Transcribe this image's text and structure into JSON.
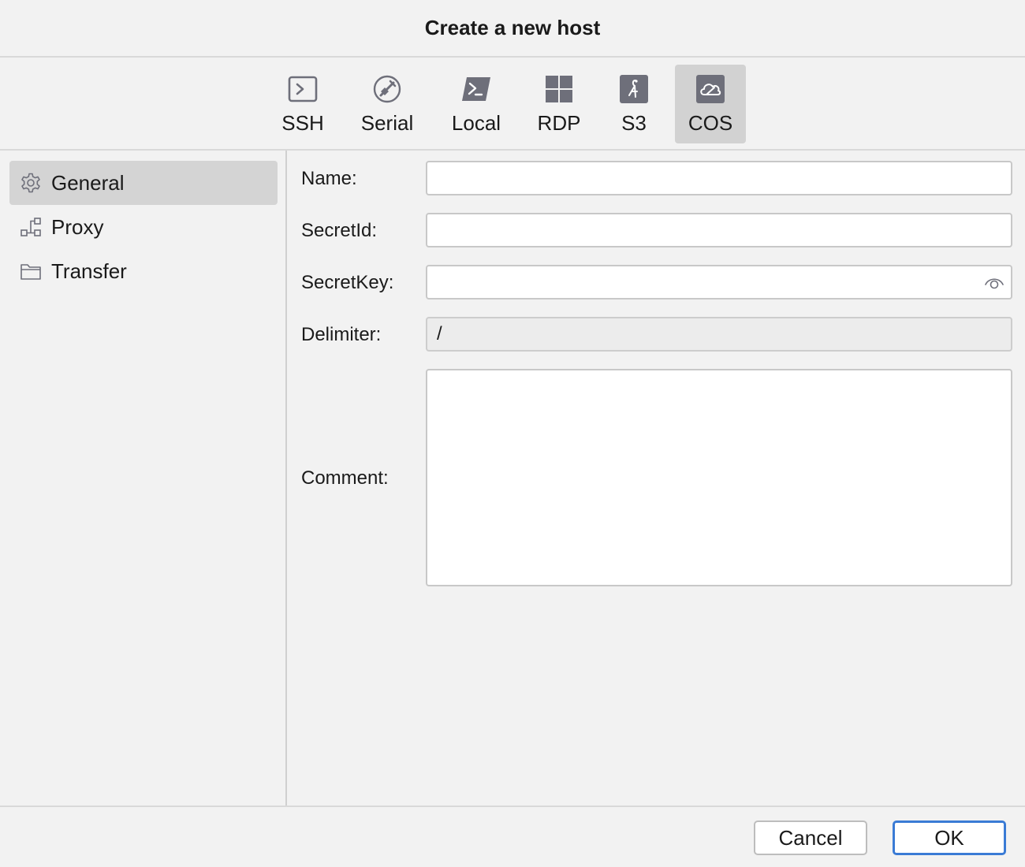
{
  "dialog": {
    "title": "Create a new host"
  },
  "host_types": [
    {
      "label": "SSH",
      "icon": "terminal-icon"
    },
    {
      "label": "Serial",
      "icon": "serial-plug-icon"
    },
    {
      "label": "Local",
      "icon": "powershell-icon"
    },
    {
      "label": "RDP",
      "icon": "windows-icon"
    },
    {
      "label": "S3",
      "icon": "s3-bird-icon"
    },
    {
      "label": "COS",
      "icon": "cloud-icon",
      "selected": true
    }
  ],
  "sidebar": {
    "items": [
      {
        "label": "General",
        "icon": "gear-icon",
        "selected": true
      },
      {
        "label": "Proxy",
        "icon": "proxy-icon"
      },
      {
        "label": "Transfer",
        "icon": "folder-icon"
      }
    ]
  },
  "form": {
    "name": {
      "label": "Name:",
      "value": ""
    },
    "secret_id": {
      "label": "SecretId:",
      "value": ""
    },
    "secret_key": {
      "label": "SecretKey:",
      "value": "",
      "icon": "eye-icon"
    },
    "delimiter": {
      "label": "Delimiter:",
      "value": "/"
    },
    "comment": {
      "label": "Comment:",
      "value": ""
    }
  },
  "footer": {
    "cancel_label": "Cancel",
    "ok_label": "OK"
  },
  "colors": {
    "accent": "#3a7bd5",
    "icon": "#6e6f7a",
    "selected_bg": "#d2d2d2"
  }
}
